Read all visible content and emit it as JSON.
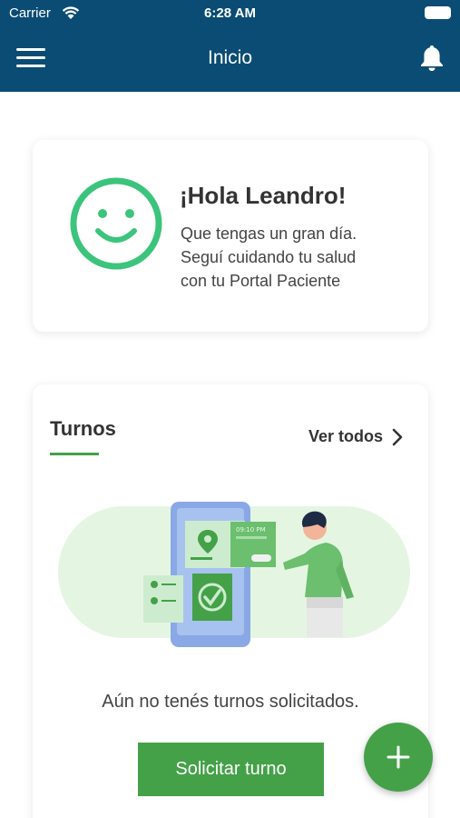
{
  "status_bar": {
    "carrier": "Carrier",
    "time": "6:28 AM"
  },
  "header": {
    "title": "Inicio",
    "menu_icon": "menu-icon",
    "notifications_icon": "bell-icon"
  },
  "greeting": {
    "title": "¡Hola Leandro!",
    "lines": [
      "Que tengas un gran día.",
      "Seguí cuidando tu salud",
      "con tu Portal Paciente"
    ],
    "icon": "smiley-icon"
  },
  "turnos": {
    "title": "Turnos",
    "ver_todos": "Ver todos",
    "illustration_time": "09:10 PM",
    "empty_message": "Aún no tenés turnos solicitados.",
    "solicitar_label": "Solicitar turno"
  },
  "fab": {
    "icon": "plus-icon"
  },
  "colors": {
    "header": "#0a4c74",
    "accent": "#44a148",
    "smiley": "#3cc47c"
  }
}
